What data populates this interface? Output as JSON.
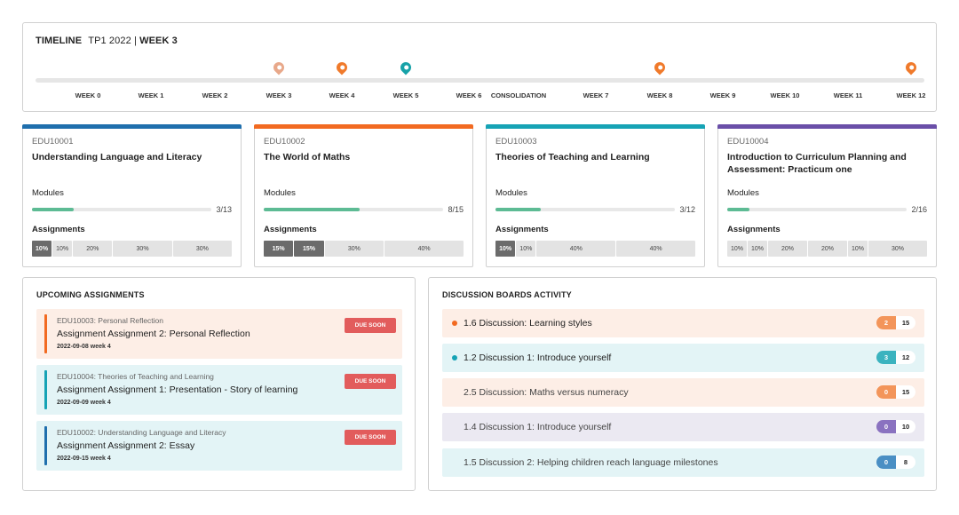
{
  "timeline": {
    "label": "TIMELINE",
    "term": "TP1 2022",
    "separator": "|",
    "current_week": "WEEK 3",
    "weeks": [
      "WEEK 0",
      "WEEK 1",
      "WEEK 2",
      "WEEK 3",
      "WEEK 4",
      "WEEK 5",
      "WEEK 6",
      "CONSOLIDATION",
      "WEEK 7",
      "WEEK 8",
      "WEEK 9",
      "WEEK 10",
      "WEEK 11",
      "WEEK 12"
    ],
    "markers": [
      {
        "week": "WEEK 3",
        "color": "#e8a88a",
        "icon": "map-pin-icon"
      },
      {
        "week": "WEEK 4",
        "color": "#f07a2b",
        "icon": "map-pin-icon"
      },
      {
        "week": "WEEK 5",
        "color": "#17a2a8",
        "icon": "map-pin-icon"
      },
      {
        "week": "WEEK 8",
        "color": "#f07a2b",
        "icon": "map-pin-icon"
      },
      {
        "week": "WEEK 12",
        "color": "#f07a2b",
        "icon": "map-pin-icon"
      }
    ]
  },
  "courses": [
    {
      "code": "EDU10001",
      "name": "Understanding Language and Literacy",
      "color": "#1f6fad",
      "modules_label": "Modules",
      "modules_done": 3,
      "modules_total": 13,
      "modules_text": "3/13",
      "assignments_label": "Assignments",
      "assignments": [
        {
          "weight": "10%",
          "done": true
        },
        {
          "weight": "10%",
          "done": false
        },
        {
          "weight": "20%",
          "done": false
        },
        {
          "weight": "30%",
          "done": false
        },
        {
          "weight": "30%",
          "done": false
        }
      ]
    },
    {
      "code": "EDU10002",
      "name": "The World of Maths",
      "color": "#f26a21",
      "modules_label": "Modules",
      "modules_done": 8,
      "modules_total": 15,
      "modules_text": "8/15",
      "assignments_label": "Assignments",
      "assignments": [
        {
          "weight": "15%",
          "done": true
        },
        {
          "weight": "15%",
          "done": true
        },
        {
          "weight": "30%",
          "done": false
        },
        {
          "weight": "40%",
          "done": false
        }
      ]
    },
    {
      "code": "EDU10003",
      "name": "Theories of Teaching and Learning",
      "color": "#16a3b5",
      "modules_label": "Modules",
      "modules_done": 3,
      "modules_total": 12,
      "modules_text": "3/12",
      "assignments_label": "Assignments",
      "assignments": [
        {
          "weight": "10%",
          "done": true
        },
        {
          "weight": "10%",
          "done": false
        },
        {
          "weight": "40%",
          "done": false
        },
        {
          "weight": "40%",
          "done": false
        }
      ]
    },
    {
      "code": "EDU10004",
      "name": "Introduction to Curriculum Planning and Assessment: Practicum one",
      "color": "#6a4fa8",
      "modules_label": "Modules",
      "modules_done": 2,
      "modules_total": 16,
      "modules_text": "2/16",
      "assignments_label": "Assignments",
      "assignments": [
        {
          "weight": "10%",
          "done": false
        },
        {
          "weight": "10%",
          "done": false
        },
        {
          "weight": "20%",
          "done": false
        },
        {
          "weight": "20%",
          "done": false
        },
        {
          "weight": "10%",
          "done": false
        },
        {
          "weight": "30%",
          "done": false
        }
      ]
    }
  ],
  "upcoming": {
    "title": "UPCOMING ASSIGNMENTS",
    "items": [
      {
        "course": "EDU10003: Personal Reflection",
        "title": "Assignment Assignment 2: Personal Reflection",
        "date": "2022-09-08 week 4",
        "badge": "DUE SOON",
        "bg": "#fdeee6",
        "stripe": "#f26a21"
      },
      {
        "course": "EDU10004: Theories of Teaching and Learning",
        "title": "Assignment Assignment 1: Presentation - Story of learning",
        "date": "2022-09-09 week 4",
        "badge": "DUE SOON",
        "bg": "#e3f4f6",
        "stripe": "#16a3b5"
      },
      {
        "course": "EDU10002: Understanding Language and Literacy",
        "title": "Assignment Assignment 2: Essay",
        "date": "2022-09-15 week 4",
        "badge": "DUE SOON",
        "bg": "#e3f4f6",
        "stripe": "#1f6fad"
      }
    ]
  },
  "discussion": {
    "title": "DISCUSSION BOARDS ACTIVITY",
    "items": [
      {
        "title": "1.6 Discussion: Learning styles",
        "new": "2",
        "total": "15",
        "bg": "#fdeee6",
        "badge_color": "#f3955a",
        "dot_color": "#f26a21",
        "unread": true
      },
      {
        "title": "1.2 Discussion 1: Introduce yourself",
        "new": "3",
        "total": "12",
        "bg": "#e3f4f6",
        "badge_color": "#3bb3bf",
        "dot_color": "#16a3b5",
        "unread": true
      },
      {
        "title": "2.5 Discussion: Maths versus numeracy",
        "new": "0",
        "total": "15",
        "bg": "#fdeee6",
        "badge_color": "#f3955a",
        "dot_color": "",
        "unread": false
      },
      {
        "title": "1.4 Discussion 1: Introduce yourself",
        "new": "0",
        "total": "10",
        "bg": "#ebe9f2",
        "badge_color": "#8a72c0",
        "dot_color": "",
        "unread": false
      },
      {
        "title": "1.5 Discussion 2: Helping children reach language milestones",
        "new": "0",
        "total": "8",
        "bg": "#e3f4f6",
        "badge_color": "#4a8fc4",
        "dot_color": "",
        "unread": false
      }
    ]
  }
}
